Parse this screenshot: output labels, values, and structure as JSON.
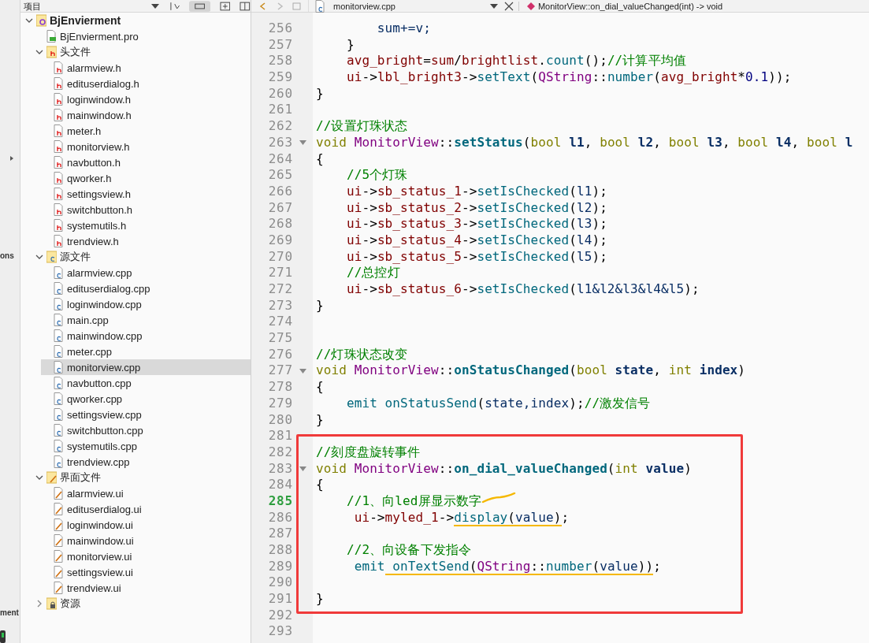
{
  "left_strip": {
    "labels": [
      "ons",
      "ment"
    ]
  },
  "sidebar": {
    "title": "项目",
    "tree": [
      {
        "label": "BjEnvierment",
        "kind": "project",
        "expanded": true,
        "selected": false,
        "children": [
          {
            "label": "BjEnvierment.pro",
            "kind": "file-pro",
            "selected": false
          },
          {
            "label": "头文件",
            "kind": "folder-h",
            "expanded": true,
            "selected": false,
            "children": [
              {
                "label": "alarmview.h",
                "kind": "file-h",
                "selected": false
              },
              {
                "label": "edituserdialog.h",
                "kind": "file-h",
                "selected": false
              },
              {
                "label": "loginwindow.h",
                "kind": "file-h",
                "selected": false
              },
              {
                "label": "mainwindow.h",
                "kind": "file-h",
                "selected": false
              },
              {
                "label": "meter.h",
                "kind": "file-h",
                "selected": false
              },
              {
                "label": "monitorview.h",
                "kind": "file-h",
                "selected": false
              },
              {
                "label": "navbutton.h",
                "kind": "file-h",
                "selected": false
              },
              {
                "label": "qworker.h",
                "kind": "file-h",
                "selected": false
              },
              {
                "label": "settingsview.h",
                "kind": "file-h",
                "selected": false
              },
              {
                "label": "switchbutton.h",
                "kind": "file-h",
                "selected": false
              },
              {
                "label": "systemutils.h",
                "kind": "file-h",
                "selected": false
              },
              {
                "label": "trendview.h",
                "kind": "file-h",
                "selected": false
              }
            ]
          },
          {
            "label": "源文件",
            "kind": "folder-cpp",
            "expanded": true,
            "selected": false,
            "children": [
              {
                "label": "alarmview.cpp",
                "kind": "file-cpp",
                "selected": false
              },
              {
                "label": "edituserdialog.cpp",
                "kind": "file-cpp",
                "selected": false
              },
              {
                "label": "loginwindow.cpp",
                "kind": "file-cpp",
                "selected": false
              },
              {
                "label": "main.cpp",
                "kind": "file-cpp",
                "selected": false
              },
              {
                "label": "mainwindow.cpp",
                "kind": "file-cpp",
                "selected": false
              },
              {
                "label": "meter.cpp",
                "kind": "file-cpp",
                "selected": false
              },
              {
                "label": "monitorview.cpp",
                "kind": "file-cpp",
                "selected": true
              },
              {
                "label": "navbutton.cpp",
                "kind": "file-cpp",
                "selected": false
              },
              {
                "label": "qworker.cpp",
                "kind": "file-cpp",
                "selected": false
              },
              {
                "label": "settingsview.cpp",
                "kind": "file-cpp",
                "selected": false
              },
              {
                "label": "switchbutton.cpp",
                "kind": "file-cpp",
                "selected": false
              },
              {
                "label": "systemutils.cpp",
                "kind": "file-cpp",
                "selected": false
              },
              {
                "label": "trendview.cpp",
                "kind": "file-cpp",
                "selected": false
              }
            ]
          },
          {
            "label": "界面文件",
            "kind": "folder-ui",
            "expanded": true,
            "selected": false,
            "children": [
              {
                "label": "alarmview.ui",
                "kind": "file-ui",
                "selected": false
              },
              {
                "label": "edituserdialog.ui",
                "kind": "file-ui",
                "selected": false
              },
              {
                "label": "loginwindow.ui",
                "kind": "file-ui",
                "selected": false
              },
              {
                "label": "mainwindow.ui",
                "kind": "file-ui",
                "selected": false
              },
              {
                "label": "monitorview.ui",
                "kind": "file-ui",
                "selected": false
              },
              {
                "label": "settingsview.ui",
                "kind": "file-ui",
                "selected": false
              },
              {
                "label": "trendview.ui",
                "kind": "file-ui",
                "selected": false
              }
            ]
          },
          {
            "label": "资源",
            "kind": "folder-res",
            "expanded": false,
            "selected": false
          }
        ]
      }
    ]
  },
  "editor": {
    "tab": {
      "label": "monitorview.cpp"
    },
    "function": "MonitorView::on_dial_valueChanged(int) -> void",
    "sections": [
      {
        "framed": false,
        "lines": [
          {
            "number": "256",
            "current": false,
            "foldable": false,
            "scribble": false,
            "tokens": [
              {
                "text": "        sum+=v;",
                "kind": "local"
              }
            ]
          },
          {
            "number": "257",
            "current": false,
            "foldable": false,
            "scribble": false,
            "tokens": [
              {
                "text": "    }",
                "kind": "plain"
              }
            ]
          },
          {
            "number": "258",
            "current": false,
            "foldable": false,
            "scribble": false,
            "tokens": [
              {
                "text": "    avg_bright",
                "kind": "member"
              },
              {
                "text": "=",
                "kind": "plain"
              },
              {
                "text": "sum",
                "kind": "member"
              },
              {
                "text": "/",
                "kind": "plain"
              },
              {
                "text": "brightlist",
                "kind": "member"
              },
              {
                "text": ".",
                "kind": "plain"
              },
              {
                "text": "count",
                "kind": "method"
              },
              {
                "text": "();",
                "kind": "plain"
              },
              {
                "text": "//计算平均值",
                "kind": "comment"
              }
            ]
          },
          {
            "number": "259",
            "current": false,
            "foldable": false,
            "scribble": false,
            "tokens": [
              {
                "text": "    ui",
                "kind": "member"
              },
              {
                "text": "->",
                "kind": "plain"
              },
              {
                "text": "lbl_bright3",
                "kind": "member"
              },
              {
                "text": "->",
                "kind": "plain"
              },
              {
                "text": "setText",
                "kind": "method"
              },
              {
                "text": "(",
                "kind": "plain"
              },
              {
                "text": "QString",
                "kind": "type"
              },
              {
                "text": "::",
                "kind": "plain"
              },
              {
                "text": "number",
                "kind": "method"
              },
              {
                "text": "(",
                "kind": "plain"
              },
              {
                "text": "avg_bright",
                "kind": "member"
              },
              {
                "text": "*",
                "kind": "plain"
              },
              {
                "text": "0.1",
                "kind": "literal"
              },
              {
                "text": "));",
                "kind": "plain"
              }
            ]
          },
          {
            "number": "260",
            "current": false,
            "foldable": false,
            "scribble": false,
            "tokens": [
              {
                "text": "}",
                "kind": "plain"
              }
            ]
          },
          {
            "number": "261",
            "current": false,
            "foldable": false,
            "scribble": false
          },
          {
            "number": "262",
            "current": false,
            "foldable": false,
            "scribble": false,
            "tokens": [
              {
                "text": "//设置灯珠状态",
                "kind": "comment"
              }
            ]
          },
          {
            "number": "263",
            "current": false,
            "foldable": true,
            "scribble": false,
            "tokens": [
              {
                "text": "void",
                "kind": "keyword"
              },
              {
                "text": " MonitorView",
                "kind": "type"
              },
              {
                "text": "::",
                "kind": "plain"
              },
              {
                "text": "setStatus",
                "kind": "func_def"
              },
              {
                "text": "(",
                "kind": "plain"
              },
              {
                "text": "bool",
                "kind": "keyword"
              },
              {
                "text": " l1",
                "kind": "param_def"
              },
              {
                "text": ",",
                "kind": "plain"
              },
              {
                "text": " bool",
                "kind": "keyword"
              },
              {
                "text": " l2",
                "kind": "param_def"
              },
              {
                "text": ",",
                "kind": "plain"
              },
              {
                "text": " bool",
                "kind": "keyword"
              },
              {
                "text": " l3",
                "kind": "param_def"
              },
              {
                "text": ",",
                "kind": "plain"
              },
              {
                "text": " bool",
                "kind": "keyword"
              },
              {
                "text": " l4",
                "kind": "param_def"
              },
              {
                "text": ",",
                "kind": "plain"
              },
              {
                "text": " bool",
                "kind": "keyword"
              },
              {
                "text": " l",
                "kind": "param_def"
              }
            ]
          },
          {
            "number": "264",
            "current": false,
            "foldable": false,
            "scribble": false,
            "tokens": [
              {
                "text": "{",
                "kind": "plain"
              }
            ]
          },
          {
            "number": "265",
            "current": false,
            "foldable": false,
            "scribble": false,
            "tokens": [
              {
                "text": "    //5个灯珠",
                "kind": "comment"
              }
            ]
          },
          {
            "number": "266",
            "current": false,
            "foldable": false,
            "scribble": false,
            "tokens": [
              {
                "text": "    ui",
                "kind": "member"
              },
              {
                "text": "->",
                "kind": "plain"
              },
              {
                "text": "sb_status_1",
                "kind": "member"
              },
              {
                "text": "->",
                "kind": "plain"
              },
              {
                "text": "setIsChecked",
                "kind": "method"
              },
              {
                "text": "(",
                "kind": "plain"
              },
              {
                "text": "l1",
                "kind": "param"
              },
              {
                "text": ");",
                "kind": "plain"
              }
            ]
          },
          {
            "number": "267",
            "current": false,
            "foldable": false,
            "scribble": false,
            "tokens": [
              {
                "text": "    ui",
                "kind": "member"
              },
              {
                "text": "->",
                "kind": "plain"
              },
              {
                "text": "sb_status_2",
                "kind": "member"
              },
              {
                "text": "->",
                "kind": "plain"
              },
              {
                "text": "setIsChecked",
                "kind": "method"
              },
              {
                "text": "(",
                "kind": "plain"
              },
              {
                "text": "l2",
                "kind": "param"
              },
              {
                "text": ");",
                "kind": "plain"
              }
            ]
          },
          {
            "number": "268",
            "current": false,
            "foldable": false,
            "scribble": false,
            "tokens": [
              {
                "text": "    ui",
                "kind": "member"
              },
              {
                "text": "->",
                "kind": "plain"
              },
              {
                "text": "sb_status_3",
                "kind": "member"
              },
              {
                "text": "->",
                "kind": "plain"
              },
              {
                "text": "setIsChecked",
                "kind": "method"
              },
              {
                "text": "(",
                "kind": "plain"
              },
              {
                "text": "l3",
                "kind": "param"
              },
              {
                "text": ");",
                "kind": "plain"
              }
            ]
          },
          {
            "number": "269",
            "current": false,
            "foldable": false,
            "scribble": false,
            "tokens": [
              {
                "text": "    ui",
                "kind": "member"
              },
              {
                "text": "->",
                "kind": "plain"
              },
              {
                "text": "sb_status_4",
                "kind": "member"
              },
              {
                "text": "->",
                "kind": "plain"
              },
              {
                "text": "setIsChecked",
                "kind": "method"
              },
              {
                "text": "(",
                "kind": "plain"
              },
              {
                "text": "l4",
                "kind": "param"
              },
              {
                "text": ");",
                "kind": "plain"
              }
            ]
          },
          {
            "number": "270",
            "current": false,
            "foldable": false,
            "scribble": false,
            "tokens": [
              {
                "text": "    ui",
                "kind": "member"
              },
              {
                "text": "->",
                "kind": "plain"
              },
              {
                "text": "sb_status_5",
                "kind": "member"
              },
              {
                "text": "->",
                "kind": "plain"
              },
              {
                "text": "setIsChecked",
                "kind": "method"
              },
              {
                "text": "(",
                "kind": "plain"
              },
              {
                "text": "l5",
                "kind": "param"
              },
              {
                "text": ");",
                "kind": "plain"
              }
            ]
          },
          {
            "number": "271",
            "current": false,
            "foldable": false,
            "scribble": false,
            "tokens": [
              {
                "text": "    //总控灯",
                "kind": "comment"
              }
            ]
          },
          {
            "number": "272",
            "current": false,
            "foldable": false,
            "scribble": false,
            "tokens": [
              {
                "text": "    ui",
                "kind": "member"
              },
              {
                "text": "->",
                "kind": "plain"
              },
              {
                "text": "sb_status_6",
                "kind": "member"
              },
              {
                "text": "->",
                "kind": "plain"
              },
              {
                "text": "setIsChecked",
                "kind": "method"
              },
              {
                "text": "(",
                "kind": "plain"
              },
              {
                "text": "l1&l2&l3&l4&l5",
                "kind": "param"
              },
              {
                "text": ");",
                "kind": "plain"
              }
            ]
          },
          {
            "number": "273",
            "current": false,
            "foldable": false,
            "scribble": false,
            "tokens": [
              {
                "text": "}",
                "kind": "plain"
              }
            ]
          },
          {
            "number": "274",
            "current": false,
            "foldable": false,
            "scribble": false
          },
          {
            "number": "275",
            "current": false,
            "foldable": false,
            "scribble": false
          },
          {
            "number": "276",
            "current": false,
            "foldable": false,
            "scribble": false,
            "tokens": [
              {
                "text": "//灯珠状态改变",
                "kind": "comment"
              }
            ]
          },
          {
            "number": "277",
            "current": false,
            "foldable": true,
            "scribble": false,
            "tokens": [
              {
                "text": "void",
                "kind": "keyword"
              },
              {
                "text": " MonitorView",
                "kind": "type"
              },
              {
                "text": "::",
                "kind": "plain"
              },
              {
                "text": "onStatusChanged",
                "kind": "func_def"
              },
              {
                "text": "(",
                "kind": "plain"
              },
              {
                "text": "bool",
                "kind": "keyword"
              },
              {
                "text": " state",
                "kind": "param_def"
              },
              {
                "text": ",",
                "kind": "plain"
              },
              {
                "text": " int",
                "kind": "keyword"
              },
              {
                "text": " index",
                "kind": "param_def"
              },
              {
                "text": ")",
                "kind": "plain"
              }
            ]
          },
          {
            "number": "278",
            "current": false,
            "foldable": false,
            "scribble": false,
            "tokens": [
              {
                "text": "{",
                "kind": "plain"
              }
            ]
          },
          {
            "number": "279",
            "current": false,
            "foldable": false,
            "scribble": false,
            "tokens": [
              {
                "text": "    emit onStatusSend",
                "kind": "method"
              },
              {
                "text": "(",
                "kind": "plain"
              },
              {
                "text": "state,index",
                "kind": "param"
              },
              {
                "text": ");",
                "kind": "plain"
              },
              {
                "text": "//激发信号",
                "kind": "comment"
              }
            ]
          },
          {
            "number": "280",
            "current": false,
            "foldable": false,
            "scribble": false,
            "tokens": [
              {
                "text": "}",
                "kind": "plain"
              }
            ]
          },
          {
            "number": "281",
            "current": false,
            "foldable": false,
            "scribble": false
          }
        ]
      },
      {
        "framed": true,
        "lines": [
          {
            "number": "282",
            "current": false,
            "foldable": false,
            "scribble": false,
            "tokens": [
              {
                "text": "//刻度盘旋转事件",
                "kind": "comment"
              }
            ]
          },
          {
            "number": "283",
            "current": false,
            "foldable": true,
            "scribble": false,
            "tokens": [
              {
                "text": "void",
                "kind": "keyword"
              },
              {
                "text": " MonitorView",
                "kind": "type"
              },
              {
                "text": "::",
                "kind": "plain"
              },
              {
                "text": "on_dial_valueChanged",
                "kind": "func_def"
              },
              {
                "text": "(",
                "kind": "plain"
              },
              {
                "text": "int",
                "kind": "keyword"
              },
              {
                "text": " value",
                "kind": "param_def"
              },
              {
                "text": ")",
                "kind": "plain"
              }
            ]
          },
          {
            "number": "284",
            "current": false,
            "foldable": false,
            "scribble": false,
            "tokens": [
              {
                "text": "{",
                "kind": "plain"
              }
            ]
          },
          {
            "number": "285",
            "current": true,
            "foldable": false,
            "scribble": true,
            "tokens": [
              {
                "text": "    //1、向led屏显示数字",
                "kind": "comment"
              }
            ]
          },
          {
            "number": "286",
            "current": false,
            "foldable": false,
            "scribble": false,
            "tokens": [
              {
                "text": "     ui",
                "kind": "member",
                "underlined": false
              },
              {
                "text": "->",
                "kind": "plain",
                "underlined": false
              },
              {
                "text": "myled_1",
                "kind": "member",
                "underlined": false
              },
              {
                "text": "->",
                "kind": "plain",
                "underlined": false
              },
              {
                "text": "display",
                "kind": "method",
                "underlined": true
              },
              {
                "text": "(",
                "kind": "plain",
                "underlined": true
              },
              {
                "text": "value",
                "kind": "param",
                "underlined": true
              },
              {
                "text": ")",
                "kind": "plain",
                "underlined": true
              },
              {
                "text": ";",
                "kind": "plain",
                "underlined": false
              }
            ]
          },
          {
            "number": "287",
            "current": false,
            "foldable": false,
            "scribble": false
          },
          {
            "number": "288",
            "current": false,
            "foldable": false,
            "scribble": false,
            "tokens": [
              {
                "text": "    //2、向设备下发指令",
                "kind": "comment"
              }
            ]
          },
          {
            "number": "289",
            "current": false,
            "foldable": false,
            "scribble": false,
            "tokens": [
              {
                "text": "     emit",
                "kind": "method",
                "underlined": false
              },
              {
                "text": " onTextSend",
                "kind": "method",
                "underlined": true
              },
              {
                "text": "(",
                "kind": "plain",
                "underlined": true
              },
              {
                "text": "QString",
                "kind": "type",
                "underlined": true
              },
              {
                "text": "::",
                "kind": "plain",
                "underlined": true
              },
              {
                "text": "number",
                "kind": "method",
                "underlined": true
              },
              {
                "text": "(",
                "kind": "plain",
                "underlined": true
              },
              {
                "text": "value",
                "kind": "param",
                "underlined": true
              },
              {
                "text": "))",
                "kind": "plain",
                "underlined": true
              },
              {
                "text": ";",
                "kind": "plain",
                "underlined": false
              }
            ]
          },
          {
            "number": "290",
            "current": false,
            "foldable": false,
            "scribble": false
          },
          {
            "number": "291",
            "current": false,
            "foldable": false,
            "scribble": false,
            "tokens": [
              {
                "text": "}",
                "kind": "plain"
              }
            ]
          }
        ]
      },
      {
        "framed": false,
        "lines": [
          {
            "number": "292",
            "current": false,
            "foldable": false,
            "scribble": false
          },
          {
            "number": "293",
            "current": false,
            "foldable": false,
            "scribble": false
          }
        ]
      }
    ]
  }
}
